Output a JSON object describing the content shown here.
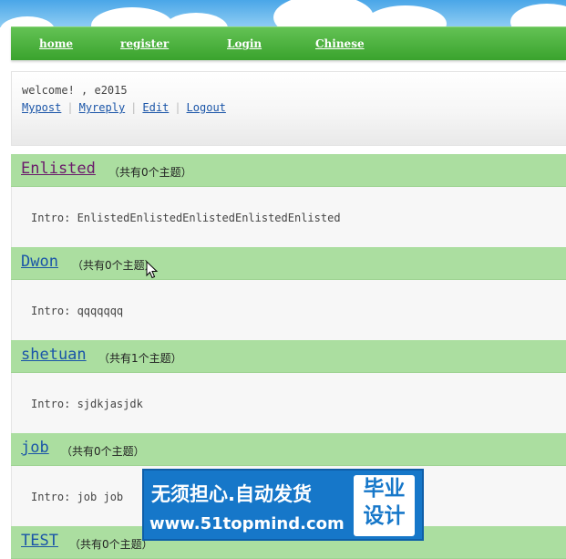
{
  "nav": {
    "items": [
      {
        "label": "home"
      },
      {
        "label": "register"
      },
      {
        "label": "Login"
      },
      {
        "label": "Chinese"
      }
    ]
  },
  "user": {
    "welcome": "welcome! , e2015",
    "links": [
      "Mypost",
      "Myreply",
      "Edit",
      "Logout"
    ]
  },
  "categories": [
    {
      "name": "Enlisted",
      "count_text": "（共有0个主题）",
      "intro": "Intro: EnlistedEnlistedEnlistedEnlistedEnlisted",
      "color": "#6b1a6b"
    },
    {
      "name": "Dwon",
      "count_text": "（共有0个主题）",
      "intro": "Intro: qqqqqqq",
      "color": "#1a55a8"
    },
    {
      "name": "shetuan",
      "count_text": "（共有1个主题）",
      "intro": "Intro: sjdkjasjdk",
      "color": "#1a55a8"
    },
    {
      "name": "job",
      "count_text": "（共有0个主题）",
      "intro": "Intro: job job",
      "color": "#1a55a8"
    },
    {
      "name": "TEST",
      "count_text": "（共有0个主题）",
      "intro": "",
      "color": "#1a55a8"
    }
  ],
  "ad": {
    "line1": "无须担心.自动发货",
    "line2": "www.51topmind.com",
    "badge": [
      "毕业",
      "设计"
    ]
  }
}
